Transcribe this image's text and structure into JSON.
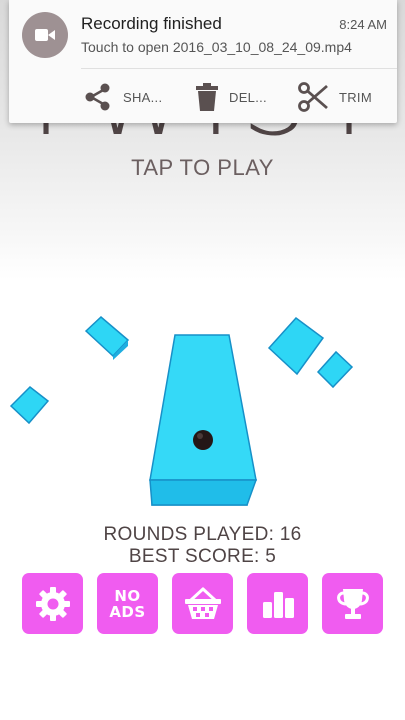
{
  "game": {
    "title": "TWIST",
    "tap_to_play": "TAP TO PLAY",
    "rounds_played_label": "ROUNDS PLAYED: 16",
    "best_score_label": "BEST SCORE: 5",
    "accent_color": "#f05cf0",
    "platform_color": "#2ed6f5"
  },
  "notification": {
    "icon": "video-camera-icon",
    "title": "Recording finished",
    "time": "8:24 AM",
    "text": "Touch to open 2016_03_10_08_24_09.mp4",
    "actions": [
      {
        "icon": "share-icon",
        "label": "SHA..."
      },
      {
        "icon": "trash-icon",
        "label": "DEL..."
      },
      {
        "icon": "scissors-icon",
        "label": "TRIM"
      }
    ]
  },
  "menu": {
    "buttons": [
      {
        "icon": "gear-icon",
        "label": ""
      },
      {
        "icon": "no-ads-icon",
        "label_line1": "NO",
        "label_line2": "ADS"
      },
      {
        "icon": "basket-icon",
        "label": ""
      },
      {
        "icon": "leaderboard-icon",
        "label": ""
      },
      {
        "icon": "trophy-icon",
        "label": ""
      }
    ]
  }
}
